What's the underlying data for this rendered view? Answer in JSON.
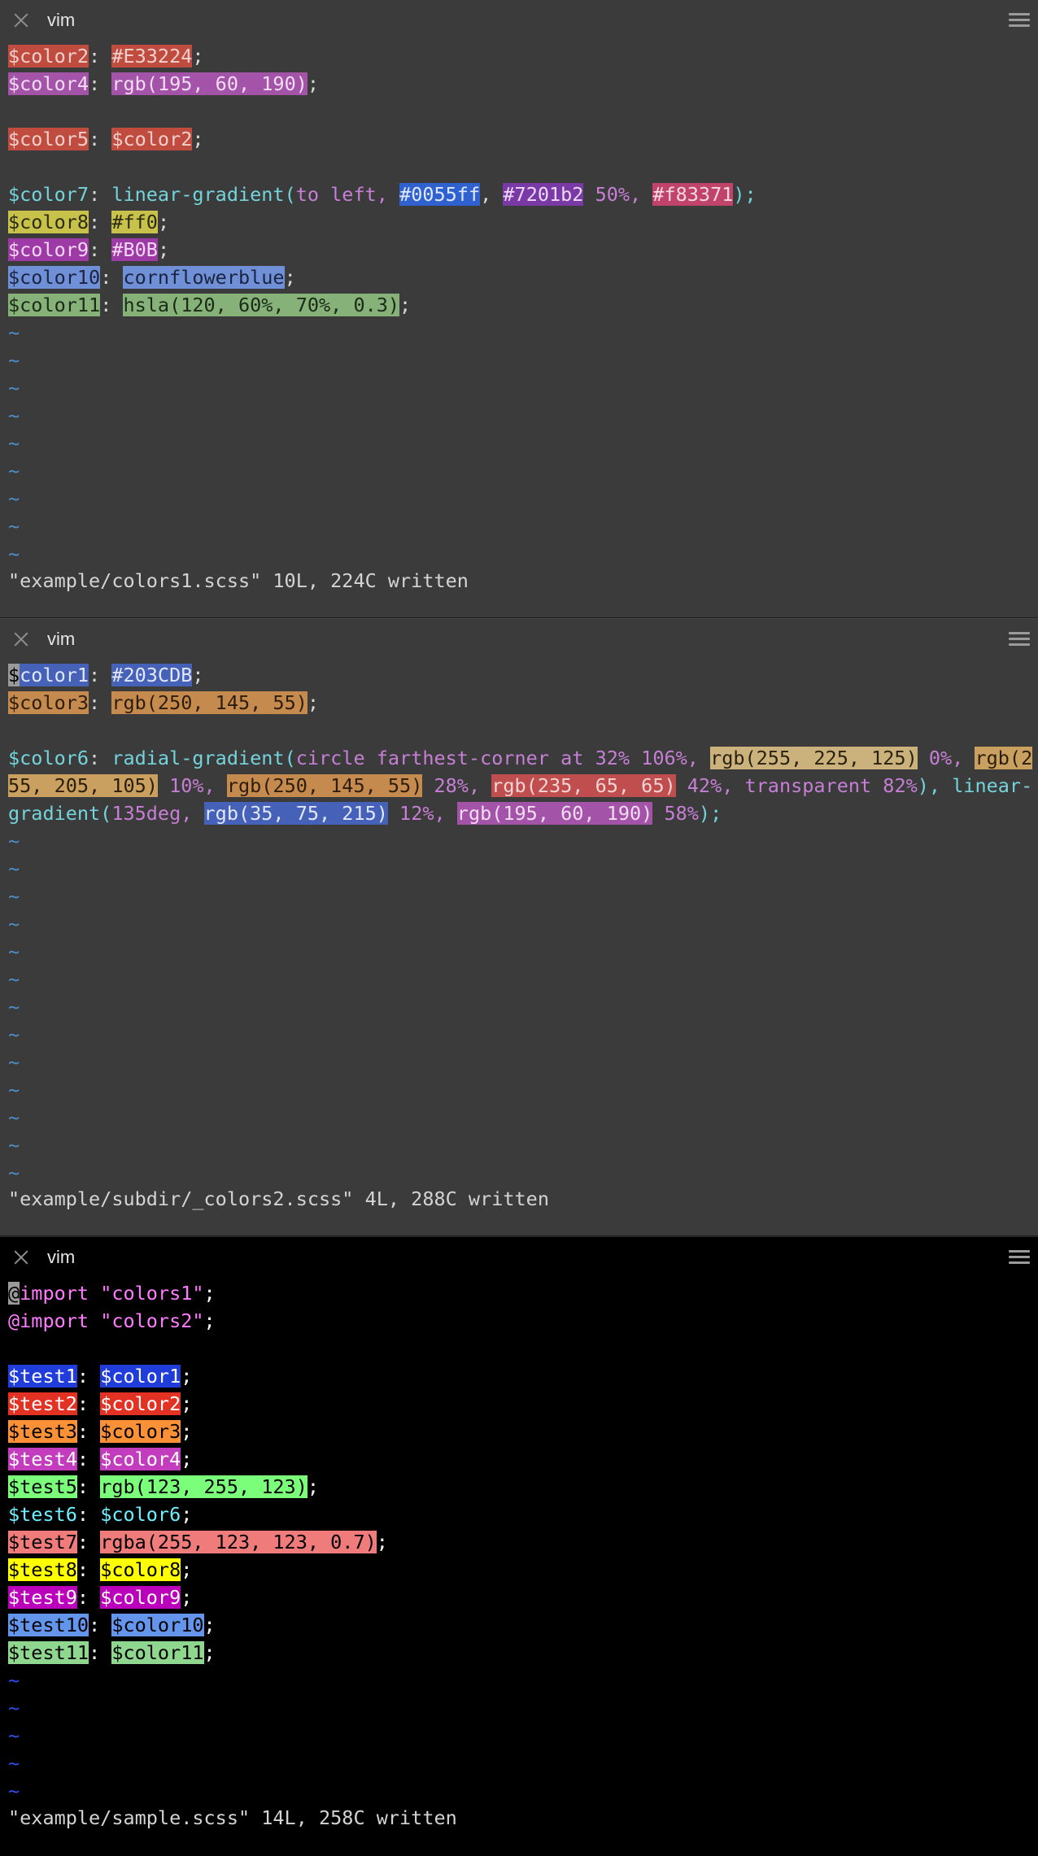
{
  "panes": [
    {
      "tab_title": "vim",
      "lines": [
        [
          {
            "t": "$color2",
            "bg": "#c04b3f",
            "c": "#f0d0cc"
          },
          {
            "t": ": ",
            "c": "#d8d8d8"
          },
          {
            "t": "#E33224",
            "bg": "#c04b3f",
            "c": "#f0d0cc"
          },
          {
            "t": ";",
            "c": "#d8d8d8"
          }
        ],
        [
          {
            "t": "$color4",
            "bg": "#a454a8",
            "c": "#f2dcf2"
          },
          {
            "t": ": ",
            "c": "#d8d8d8"
          },
          {
            "t": "rgb(195, 60, 190)",
            "bg": "#a454a8",
            "c": "#f2dcf2"
          },
          {
            "t": ";",
            "c": "#d8d8d8"
          }
        ],
        [],
        [
          {
            "t": "$color5",
            "bg": "#c04b3f",
            "c": "#f0d0cc"
          },
          {
            "t": ": ",
            "c": "#d8d8d8"
          },
          {
            "t": "$color2",
            "bg": "#c04b3f",
            "c": "#f0d0cc"
          },
          {
            "t": ";",
            "c": "#d8d8d8"
          }
        ],
        [],
        [
          {
            "t": "$color7",
            "c": "#74d4dc"
          },
          {
            "t": ": ",
            "c": "#d8d8d8"
          },
          {
            "t": "linear-gradient(",
            "c": "#74d4dc"
          },
          {
            "t": "to left, ",
            "c": "#c77fd6"
          },
          {
            "t": "#0055ff",
            "bg": "#2f62cf",
            "c": "#dfe8ff"
          },
          {
            "t": ", ",
            "c": "#d8d8d8"
          },
          {
            "t": "#7201b2",
            "bg": "#7a3aa6",
            "c": "#ecd8f8"
          },
          {
            "t": " 50%, ",
            "c": "#c77fd6"
          },
          {
            "t": "#f83371",
            "bg": "#c0436a",
            "c": "#f8d8e2"
          },
          {
            "t": ");",
            "c": "#74d4dc"
          }
        ],
        [
          {
            "t": "$color8",
            "bg": "#c9c24a",
            "c": "#2b2b10"
          },
          {
            "t": ": ",
            "c": "#d8d8d8"
          },
          {
            "t": "#ff0",
            "bg": "#c9c24a",
            "c": "#2b2b10"
          },
          {
            "t": ";",
            "c": "#d8d8d8"
          }
        ],
        [
          {
            "t": "$color9",
            "bg": "#9e3aa6",
            "c": "#f2d8f4"
          },
          {
            "t": ": ",
            "c": "#d8d8d8"
          },
          {
            "t": "#B0B",
            "bg": "#9e3aa6",
            "c": "#f2d8f4"
          },
          {
            "t": ";",
            "c": "#d8d8d8"
          }
        ],
        [
          {
            "t": "$color10",
            "bg": "#6f8fd6",
            "c": "#1c2540"
          },
          {
            "t": ": ",
            "c": "#d8d8d8"
          },
          {
            "t": "cornflowerblue",
            "bg": "#6f8fd6",
            "c": "#1c2540"
          },
          {
            "t": ";",
            "c": "#d8d8d8"
          }
        ],
        [
          {
            "t": "$color11",
            "bg": "#86b27a",
            "c": "#1c2a18"
          },
          {
            "t": ": ",
            "c": "#d8d8d8"
          },
          {
            "t": "hsla(120, 60%, 70%, 0.3)",
            "bg": "#86b27a",
            "c": "#1c2a18"
          },
          {
            "t": ";",
            "c": "#d8d8d8"
          }
        ]
      ],
      "tildes": 9,
      "message": "\"example/colors1.scss\" 10L, 224C written"
    },
    {
      "tab_title": "vim",
      "lines": [
        [
          {
            "t": "$",
            "bg": "#9a9a9a",
            "c": "#000000"
          },
          {
            "t": "color1",
            "bg": "#4561b8",
            "c": "#e2e8fa"
          },
          {
            "t": ": ",
            "c": "#d8d8d8"
          },
          {
            "t": "#203CDB",
            "bg": "#4561b8",
            "c": "#e2e8fa"
          },
          {
            "t": ";",
            "c": "#d8d8d8"
          }
        ],
        [
          {
            "t": "$color3",
            "bg": "#c58a4e",
            "c": "#2d1d0c"
          },
          {
            "t": ": ",
            "c": "#d8d8d8"
          },
          {
            "t": "rgb(250, 145, 55)",
            "bg": "#c58a4e",
            "c": "#2d1d0c"
          },
          {
            "t": ";",
            "c": "#d8d8d8"
          }
        ],
        [],
        [
          {
            "t": "$color6",
            "c": "#74d4dc"
          },
          {
            "t": ": ",
            "c": "#d8d8d8"
          },
          {
            "t": "radial-gradient(",
            "c": "#74d4dc"
          },
          {
            "t": "circle farthest-corner at 32% 106%, ",
            "c": "#c77fd6"
          },
          {
            "t": "rgb(255, 225, 125)",
            "bg": "#cbb27c",
            "c": "#2a2210"
          },
          {
            "t": " 0%, ",
            "c": "#c77fd6"
          },
          {
            "t": "rgb(2",
            "bg": "#c9a060",
            "c": "#2a1e08"
          }
        ],
        [
          {
            "t": "55, 205, 105)",
            "bg": "#c9a060",
            "c": "#2a1e08"
          },
          {
            "t": " 10%, ",
            "c": "#c77fd6"
          },
          {
            "t": "rgb(250, 145, 55)",
            "bg": "#c58a4e",
            "c": "#2d1d0c"
          },
          {
            "t": " 28%, ",
            "c": "#c77fd6"
          },
          {
            "t": "rgb(235, 65, 65)",
            "bg": "#c04e4e",
            "c": "#f4d4d4"
          },
          {
            "t": " 42%, transparent 82%",
            "c": "#c77fd6"
          },
          {
            "t": "), linear-",
            "c": "#74d4dc"
          }
        ],
        [
          {
            "t": "gradient(",
            "c": "#74d4dc"
          },
          {
            "t": "135deg, ",
            "c": "#c77fd6"
          },
          {
            "t": "rgb(35, 75, 215)",
            "bg": "#4561b8",
            "c": "#e2e8fa"
          },
          {
            "t": " 12%, ",
            "c": "#c77fd6"
          },
          {
            "t": "rgb(195, 60, 190)",
            "bg": "#a454a8",
            "c": "#f2dcf2"
          },
          {
            "t": " 58%",
            "c": "#c77fd6"
          },
          {
            "t": ");",
            "c": "#74d4dc"
          }
        ]
      ],
      "tildes": 13,
      "message": "\"example/subdir/_colors2.scss\" 4L, 288C written"
    },
    {
      "tab_title": "vim",
      "lines": [
        [
          {
            "t": "@",
            "bg": "#9a9a9a",
            "c": "#000000"
          },
          {
            "t": "import ",
            "c": "#ff7bff"
          },
          {
            "t": "\"colors1\"",
            "c": "#ff7bff"
          },
          {
            "t": ";",
            "c": "#ffffff"
          }
        ],
        [
          {
            "t": "@import ",
            "c": "#ff7bff"
          },
          {
            "t": "\"colors2\"",
            "c": "#ff7bff"
          },
          {
            "t": ";",
            "c": "#ffffff"
          }
        ],
        [],
        [
          {
            "t": "$test1",
            "bg": "#203cdb",
            "c": "#ffffff"
          },
          {
            "t": ": ",
            "c": "#ffffff"
          },
          {
            "t": "$color1",
            "bg": "#203cdb",
            "c": "#ffffff"
          },
          {
            "t": ";",
            "c": "#ffffff"
          }
        ],
        [
          {
            "t": "$test2",
            "bg": "#e33224",
            "c": "#ffffff"
          },
          {
            "t": ": ",
            "c": "#ffffff"
          },
          {
            "t": "$color2",
            "bg": "#e33224",
            "c": "#ffffff"
          },
          {
            "t": ";",
            "c": "#ffffff"
          }
        ],
        [
          {
            "t": "$test3",
            "bg": "#fa9137",
            "c": "#000000"
          },
          {
            "t": ": ",
            "c": "#ffffff"
          },
          {
            "t": "$color3",
            "bg": "#fa9137",
            "c": "#000000"
          },
          {
            "t": ";",
            "c": "#ffffff"
          }
        ],
        [
          {
            "t": "$test4",
            "bg": "#c33cbe",
            "c": "#ffffff"
          },
          {
            "t": ": ",
            "c": "#ffffff"
          },
          {
            "t": "$color4",
            "bg": "#c33cbe",
            "c": "#ffffff"
          },
          {
            "t": ";",
            "c": "#ffffff"
          }
        ],
        [
          {
            "t": "$test5",
            "bg": "#7bff7b",
            "c": "#000000"
          },
          {
            "t": ": ",
            "c": "#ffffff"
          },
          {
            "t": "rgb(123, 255, 123)",
            "bg": "#7bff7b",
            "c": "#000000"
          },
          {
            "t": ";",
            "c": "#ffffff"
          }
        ],
        [
          {
            "t": "$test6",
            "c": "#6ef0ff"
          },
          {
            "t": ": ",
            "c": "#ffffff"
          },
          {
            "t": "$color6",
            "c": "#6ef0ff"
          },
          {
            "t": ";",
            "c": "#ffffff"
          }
        ],
        [
          {
            "t": "$test7",
            "bg": "#f07b7b",
            "c": "#000000"
          },
          {
            "t": ": ",
            "c": "#ffffff"
          },
          {
            "t": "rgba(255, 123, 123, 0.7)",
            "bg": "#f07b7b",
            "c": "#000000"
          },
          {
            "t": ";",
            "c": "#ffffff"
          }
        ],
        [
          {
            "t": "$test8",
            "bg": "#ffff00",
            "c": "#000000"
          },
          {
            "t": ": ",
            "c": "#ffffff"
          },
          {
            "t": "$color8",
            "bg": "#ffff00",
            "c": "#000000"
          },
          {
            "t": ";",
            "c": "#ffffff"
          }
        ],
        [
          {
            "t": "$test9",
            "bg": "#bb00bb",
            "c": "#ffffff"
          },
          {
            "t": ": ",
            "c": "#ffffff"
          },
          {
            "t": "$color9",
            "bg": "#bb00bb",
            "c": "#ffffff"
          },
          {
            "t": ";",
            "c": "#ffffff"
          }
        ],
        [
          {
            "t": "$test10",
            "bg": "#6495ed",
            "c": "#000000"
          },
          {
            "t": ": ",
            "c": "#ffffff"
          },
          {
            "t": "$color10",
            "bg": "#6495ed",
            "c": "#000000"
          },
          {
            "t": ";",
            "c": "#ffffff"
          }
        ],
        [
          {
            "t": "$test11",
            "bg": "#8fd68f",
            "c": "#000000"
          },
          {
            "t": ": ",
            "c": "#ffffff"
          },
          {
            "t": "$color11",
            "bg": "#8fd68f",
            "c": "#000000"
          },
          {
            "t": ";",
            "c": "#ffffff"
          }
        ]
      ],
      "tildes": 5,
      "message": "\"example/sample.scss\" 14L, 258C written"
    }
  ]
}
